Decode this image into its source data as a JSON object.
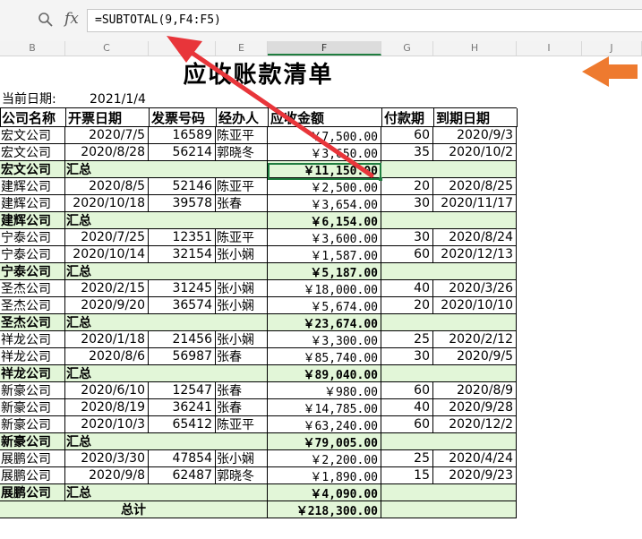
{
  "formula_bar": {
    "zoom_icon": "magnifier-icon",
    "fx_label": "fx",
    "formula": "=SUBTOTAL(9,F4:F5)"
  },
  "columns": [
    "B",
    "C",
    "D",
    "E",
    "F",
    "G",
    "H",
    "I",
    "J"
  ],
  "selected_column": "F",
  "sheet": {
    "title": "应收账款清单",
    "date_label": "当前日期:",
    "date_value": "2021/1/4",
    "headers": [
      "公司名称",
      "开票日期",
      "发票号码",
      "经办人",
      "应收金额",
      "付款期",
      "到期日期"
    ],
    "rows": [
      {
        "type": "data",
        "company": "宏文公司",
        "date": "2020/7/5",
        "invoice": "16589",
        "handler": "陈亚平",
        "amount": "￥7,500.00",
        "term": "60",
        "due": "2020/9/3"
      },
      {
        "type": "data",
        "company": "宏文公司",
        "date": "2020/8/28",
        "invoice": "56214",
        "handler": "郭晓冬",
        "amount": "￥3,650.00",
        "term": "35",
        "due": "2020/10/2"
      },
      {
        "type": "subtotal",
        "company": "宏文公司",
        "label": "汇总",
        "amount": "￥11,150.00"
      },
      {
        "type": "data",
        "company": "建辉公司",
        "date": "2020/8/5",
        "invoice": "52146",
        "handler": "陈亚平",
        "amount": "￥2,500.00",
        "term": "20",
        "due": "2020/8/25"
      },
      {
        "type": "data",
        "company": "建辉公司",
        "date": "2020/10/18",
        "invoice": "39578",
        "handler": "张春",
        "amount": "￥3,654.00",
        "term": "30",
        "due": "2020/11/17"
      },
      {
        "type": "subtotal",
        "company": "建辉公司",
        "label": "汇总",
        "amount": "￥6,154.00"
      },
      {
        "type": "data",
        "company": "宁泰公司",
        "date": "2020/7/25",
        "invoice": "12351",
        "handler": "陈亚平",
        "amount": "￥3,600.00",
        "term": "30",
        "due": "2020/8/24"
      },
      {
        "type": "data",
        "company": "宁泰公司",
        "date": "2020/10/14",
        "invoice": "32154",
        "handler": "张小娴",
        "amount": "￥1,587.00",
        "term": "60",
        "due": "2020/12/13"
      },
      {
        "type": "subtotal",
        "company": "宁泰公司",
        "label": "汇总",
        "amount": "￥5,187.00"
      },
      {
        "type": "data",
        "company": "圣杰公司",
        "date": "2020/2/15",
        "invoice": "31245",
        "handler": "张小娴",
        "amount": "￥18,000.00",
        "term": "40",
        "due": "2020/3/26"
      },
      {
        "type": "data",
        "company": "圣杰公司",
        "date": "2020/9/20",
        "invoice": "36574",
        "handler": "张小娴",
        "amount": "￥5,674.00",
        "term": "20",
        "due": "2020/10/10"
      },
      {
        "type": "subtotal",
        "company": "圣杰公司",
        "label": "汇总",
        "amount": "￥23,674.00"
      },
      {
        "type": "data",
        "company": "祥龙公司",
        "date": "2020/1/18",
        "invoice": "21456",
        "handler": "张小娴",
        "amount": "￥3,300.00",
        "term": "25",
        "due": "2020/2/12"
      },
      {
        "type": "data",
        "company": "祥龙公司",
        "date": "2020/8/6",
        "invoice": "56987",
        "handler": "张春",
        "amount": "￥85,740.00",
        "term": "30",
        "due": "2020/9/5"
      },
      {
        "type": "subtotal",
        "company": "祥龙公司",
        "label": "汇总",
        "amount": "￥89,040.00"
      },
      {
        "type": "data",
        "company": "新豪公司",
        "date": "2020/6/10",
        "invoice": "12547",
        "handler": "张春",
        "amount": "￥980.00",
        "term": "60",
        "due": "2020/8/9"
      },
      {
        "type": "data",
        "company": "新豪公司",
        "date": "2020/8/19",
        "invoice": "36241",
        "handler": "张春",
        "amount": "￥14,785.00",
        "term": "40",
        "due": "2020/9/28"
      },
      {
        "type": "data",
        "company": "新豪公司",
        "date": "2020/10/3",
        "invoice": "65412",
        "handler": "陈亚平",
        "amount": "￥63,240.00",
        "term": "60",
        "due": "2020/12/2"
      },
      {
        "type": "subtotal",
        "company": "新豪公司",
        "label": "汇总",
        "amount": "￥79,005.00"
      },
      {
        "type": "data",
        "company": "展鹏公司",
        "date": "2020/3/30",
        "invoice": "47854",
        "handler": "张小娴",
        "amount": "￥2,200.00",
        "term": "25",
        "due": "2020/4/24"
      },
      {
        "type": "data",
        "company": "展鹏公司",
        "date": "2020/9/8",
        "invoice": "62487",
        "handler": "郭晓冬",
        "amount": "￥1,890.00",
        "term": "15",
        "due": "2020/9/23"
      },
      {
        "type": "subtotal",
        "company": "展鹏公司",
        "label": "汇总",
        "amount": "￥4,090.00"
      },
      {
        "type": "total",
        "label": "总计",
        "amount": "￥218,300.00"
      }
    ]
  },
  "annotations": {
    "red_arrow": "arrow-to-formula-icon",
    "orange_arrow": "arrow-left-icon",
    "red_color": "#e8353a",
    "orange_color": "#ee7a2f"
  },
  "colors": {
    "subtotal_fill": "#e2f6d8",
    "selection_border": "#1f7d3f"
  }
}
